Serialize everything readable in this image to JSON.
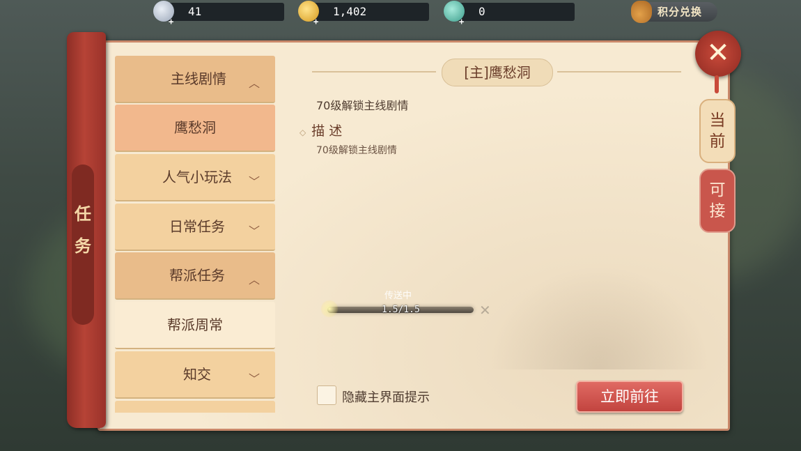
{
  "topbar": {
    "silver": "41",
    "gold": "1,402",
    "jade": "0",
    "exchange_label": "积分兑换"
  },
  "sidebar": {
    "title": "任务"
  },
  "menu": {
    "items": [
      {
        "label": "主线剧情",
        "state": "expanded"
      },
      {
        "label": "鹰愁洞",
        "state": "selected"
      },
      {
        "label": "人气小玩法",
        "state": "collapsed"
      },
      {
        "label": "日常任务",
        "state": "collapsed"
      },
      {
        "label": "帮派任务",
        "state": "expanded"
      },
      {
        "label": "帮派周常",
        "state": "subitem"
      },
      {
        "label": "知交",
        "state": "collapsed"
      }
    ]
  },
  "quest": {
    "title": "[主]鹰愁洞",
    "requirement": "70级解锁主线剧情",
    "desc_heading": "描 述",
    "desc_text": "70级解锁主线剧情"
  },
  "teleport": {
    "label": "传送中",
    "value": "1.5/1.5",
    "progress": 1.0
  },
  "footer": {
    "hide_hint_label": "隐藏主界面提示",
    "go_button": "立即前往"
  },
  "tabs": {
    "current": "当前",
    "available": "可接"
  },
  "colors": {
    "accent_red": "#c2443f",
    "panel_bg": "#f7ead2",
    "menu_active": "#f2b88d"
  }
}
